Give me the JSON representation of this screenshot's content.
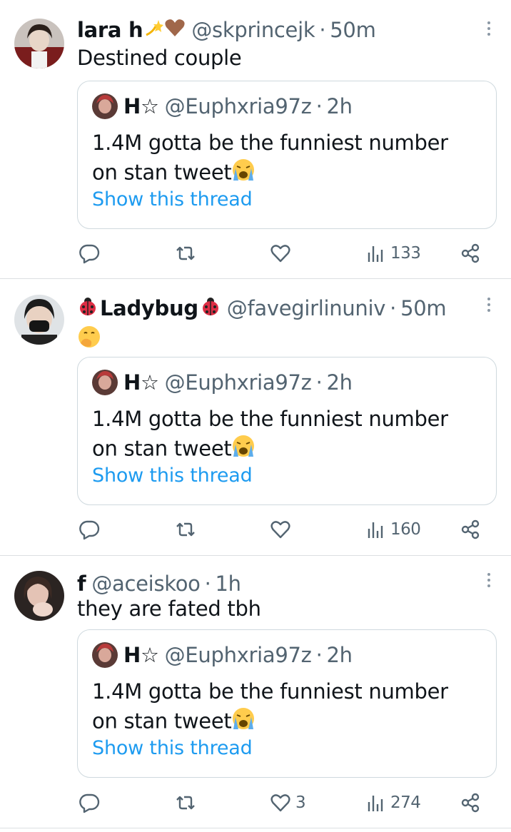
{
  "tweets": [
    {
      "name": "lara h",
      "handle": "@skprincejk",
      "time": "50m",
      "text": "Destined couple",
      "quote": {
        "name": "H☆",
        "handle": "@Euphxria97z",
        "time": "2h",
        "text": "1.4M gotta be the funniest number on stan tweet",
        "link": "Show this thread"
      },
      "likes": "",
      "views": "133"
    },
    {
      "name": "Ladybug",
      "handle": "@favegirlinuniv",
      "time": "50m",
      "text": "",
      "quote": {
        "name": "H☆",
        "handle": "@Euphxria97z",
        "time": "2h",
        "text": "1.4M gotta be the funniest number on stan tweet",
        "link": "Show this thread"
      },
      "likes": "",
      "views": "160"
    },
    {
      "name": "f",
      "handle": "@aceiskoo",
      "time": "1h",
      "text": "they are fated tbh",
      "quote": {
        "name": "H☆",
        "handle": "@Euphxria97z",
        "time": "2h",
        "text": "1.4M gotta be the funniest number on stan tweet",
        "link": "Show this thread"
      },
      "likes": "3",
      "views": "274"
    }
  ],
  "separator": "·",
  "icons": [
    "reply-icon",
    "retweet-icon",
    "like-icon",
    "views-icon",
    "share-icon",
    "more-options-icon",
    "dizzy-emoji-icon",
    "brown-heart-emoji-icon",
    "ladybug-emoji-icon",
    "face-with-hand-over-mouth-emoji-icon",
    "crying-face-emoji-icon"
  ],
  "colors": {
    "link": "#1d9bf0",
    "secondary": "#536471",
    "border": "#cfd9de"
  }
}
